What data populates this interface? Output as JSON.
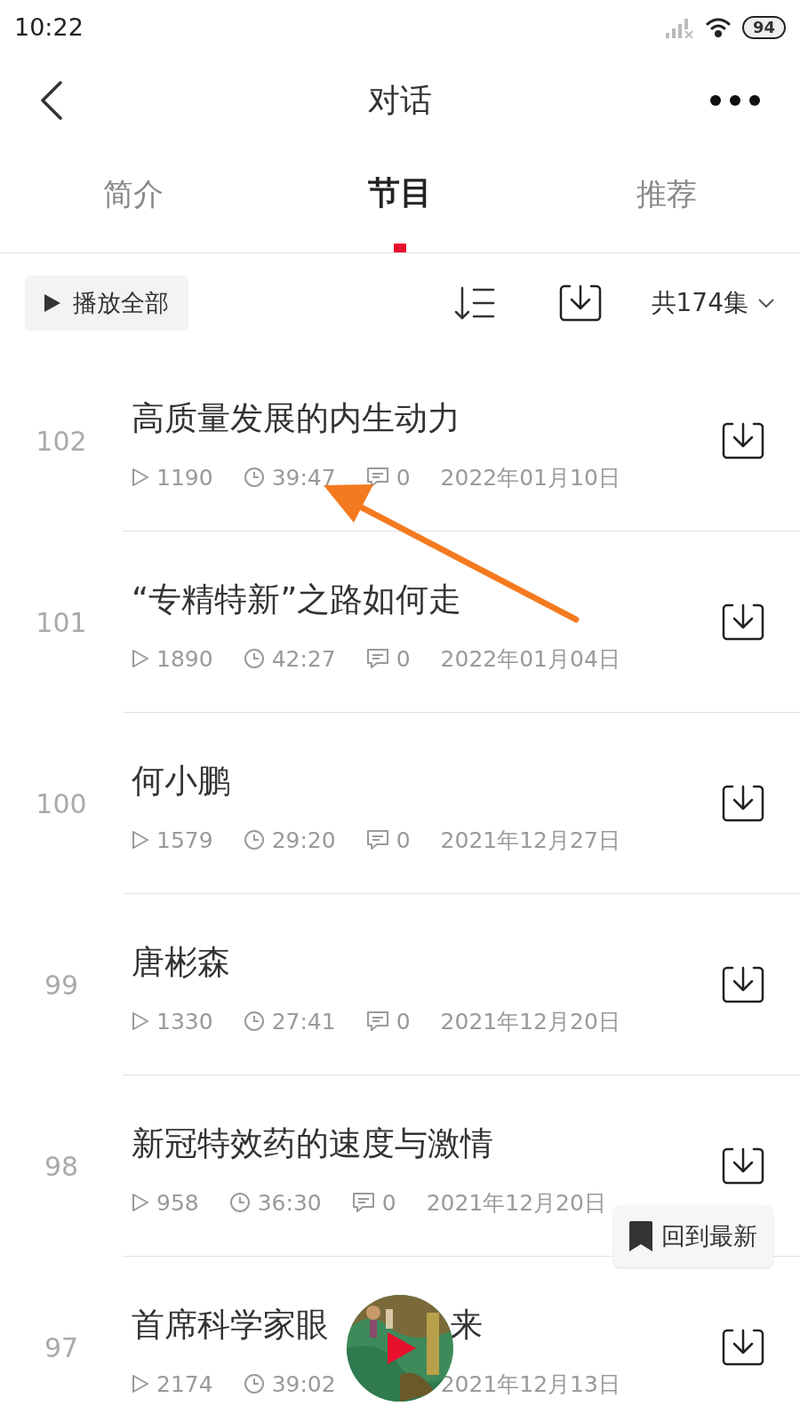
{
  "status_bar": {
    "time": "10:22",
    "battery": "94"
  },
  "header": {
    "title": "对话"
  },
  "tabs": [
    {
      "label": "简介",
      "selected": false
    },
    {
      "label": "节目",
      "selected": true
    },
    {
      "label": "推荐",
      "selected": false
    }
  ],
  "toolbar": {
    "play_all": "播放全部",
    "episode_count": "共174集"
  },
  "episodes": [
    {
      "number": "102",
      "title_parts": [
        "高质量发展的内生动力"
      ],
      "plays": "1190",
      "duration": "39:47",
      "comments": "0",
      "date": "2022年01月10日"
    },
    {
      "number": "101",
      "title_parts": [
        "“专精特新”之路如何走"
      ],
      "plays": "1890",
      "duration": "42:27",
      "comments": "0",
      "date": "2022年01月04日"
    },
    {
      "number": "100",
      "title_parts": [
        "何小鹏"
      ],
      "plays": "1579",
      "duration": "29:20",
      "comments": "0",
      "date": "2021年12月27日"
    },
    {
      "number": "99",
      "title_parts": [
        "唐彬森"
      ],
      "plays": "1330",
      "duration": "27:41",
      "comments": "0",
      "date": "2021年12月20日"
    },
    {
      "number": "98",
      "title_parts": [
        "新冠特效药的速度与激情"
      ],
      "plays": "958",
      "duration": "36:30",
      "comments": "0",
      "date": "2021年12月20日"
    },
    {
      "number": "97",
      "title_parts": [
        "首席科学家眼",
        "来"
      ],
      "plays": "2174",
      "duration": "39:02",
      "date": "2021年12月13日"
    }
  ],
  "back_to_latest": "回到最新"
}
